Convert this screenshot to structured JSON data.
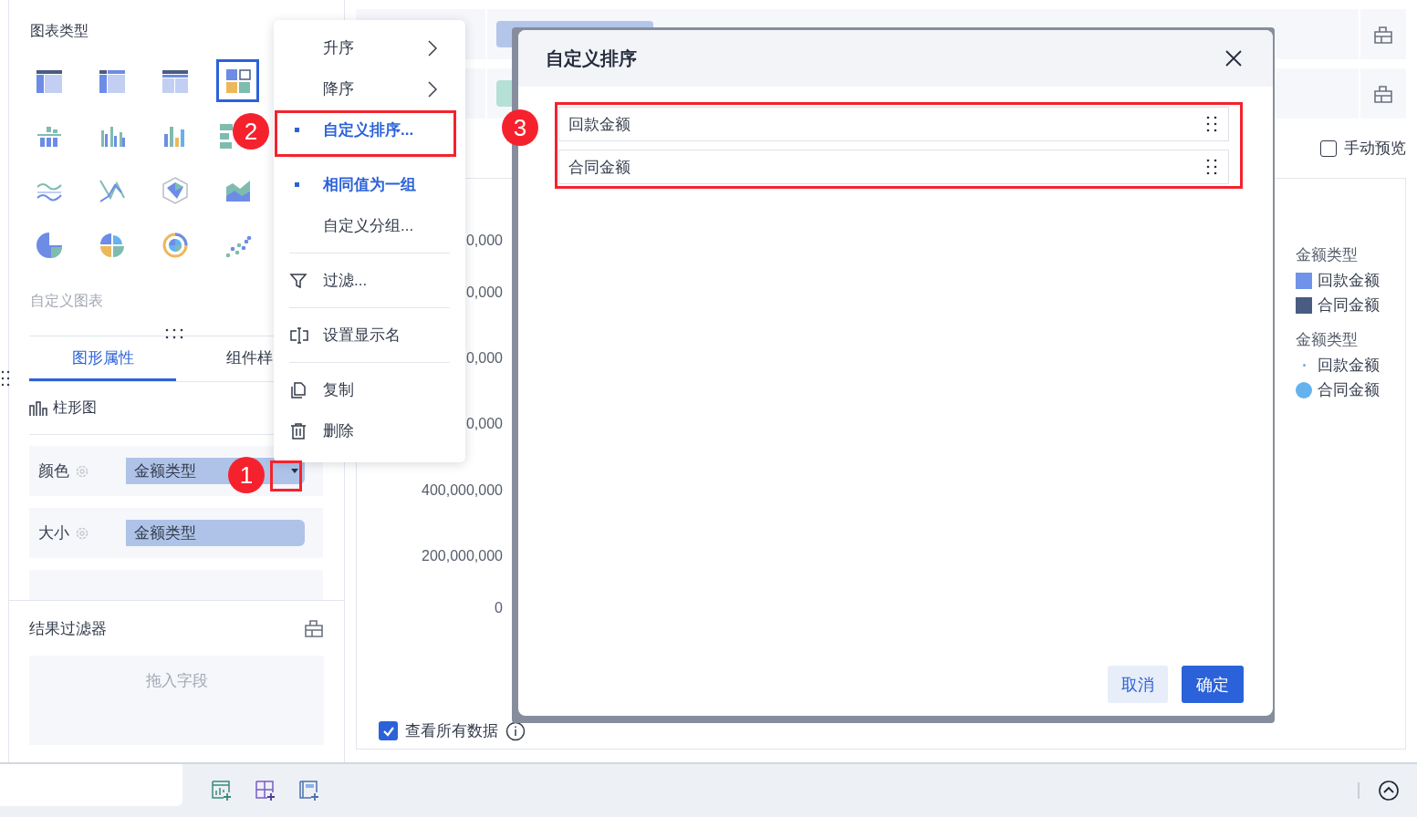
{
  "left_panel": {
    "chart_type_title": "图表类型",
    "chart_types": [
      {
        "kind": "table",
        "selected": false
      },
      {
        "kind": "pivot",
        "selected": false
      },
      {
        "kind": "detail",
        "selected": false
      },
      {
        "kind": "grid",
        "selected": true
      },
      {
        "kind": "stack-bar",
        "selected": false
      },
      {
        "kind": "group-bar",
        "selected": false
      },
      {
        "kind": "bar",
        "selected": false
      },
      {
        "kind": "hbar",
        "selected": false
      },
      {
        "kind": "wave",
        "selected": false
      },
      {
        "kind": "line",
        "selected": false
      },
      {
        "kind": "radar",
        "selected": false
      },
      {
        "kind": "area",
        "selected": false
      },
      {
        "kind": "pie",
        "selected": false
      },
      {
        "kind": "rose",
        "selected": false
      },
      {
        "kind": "ring",
        "selected": false
      },
      {
        "kind": "scatter",
        "selected": false
      }
    ],
    "custom_chart": "自定义图表",
    "tabs": [
      {
        "label": "图形属性",
        "selected": true
      },
      {
        "label": "组件样",
        "selected": false
      }
    ],
    "chart_name": "柱形图",
    "properties": [
      {
        "label": "颜色",
        "kind": "field",
        "value": "金额类型",
        "dropdown": true
      },
      {
        "label": "大小",
        "kind": "field",
        "value": "金额类型",
        "dropdown": false
      }
    ],
    "result_filter": {
      "title": "结果过滤器",
      "placeholder": "拖入字段"
    }
  },
  "field_rows": [
    {
      "color": "#b3c6ea"
    },
    {
      "color": "#b5e0d6"
    }
  ],
  "manual_preview": {
    "label": "手动预览",
    "checked": false
  },
  "chart": {
    "y_labels": [
      "0,000",
      "0,000",
      "0,000",
      "0,000",
      "400,000,000",
      "200,000,000",
      "0"
    ],
    "legends": [
      {
        "title": "金额类型",
        "kind": "color",
        "items": [
          {
            "label": "回款金额",
            "color": "#6f93e8"
          },
          {
            "label": "合同金额",
            "color": "#4b5c82"
          }
        ]
      },
      {
        "title": "金额类型",
        "kind": "size",
        "items": [
          {
            "label": "回款金额",
            "color": "#64b2ee"
          },
          {
            "label": "合同金额",
            "color": "#64b2ee"
          }
        ]
      }
    ]
  },
  "view_all": {
    "label": "查看所有数据",
    "checked": true
  },
  "context_menu": {
    "groups": [
      [
        {
          "label": "升序",
          "kind": "submenu",
          "selected": false
        },
        {
          "label": "降序",
          "kind": "submenu",
          "selected": false
        },
        {
          "label": "自定义排序...",
          "kind": "option",
          "selected": true
        }
      ],
      [
        {
          "label": "相同值为一组",
          "kind": "option",
          "selected": true
        },
        {
          "label": "自定义分组...",
          "kind": "option",
          "selected": false
        }
      ],
      [
        {
          "label": "过滤...",
          "kind": "filter"
        }
      ],
      [
        {
          "label": "设置显示名",
          "kind": "rename"
        }
      ],
      [
        {
          "label": "复制",
          "kind": "copy"
        },
        {
          "label": "删除",
          "kind": "delete"
        }
      ]
    ]
  },
  "dialog": {
    "title": "自定义排序",
    "items": [
      "回款金额",
      "合同金额"
    ],
    "buttons": [
      {
        "label": "取消",
        "kind": "secondary"
      },
      {
        "label": "确定",
        "kind": "primary"
      }
    ]
  },
  "annotations": [
    {
      "label": "1"
    },
    {
      "label": "2"
    },
    {
      "label": "3"
    }
  ]
}
